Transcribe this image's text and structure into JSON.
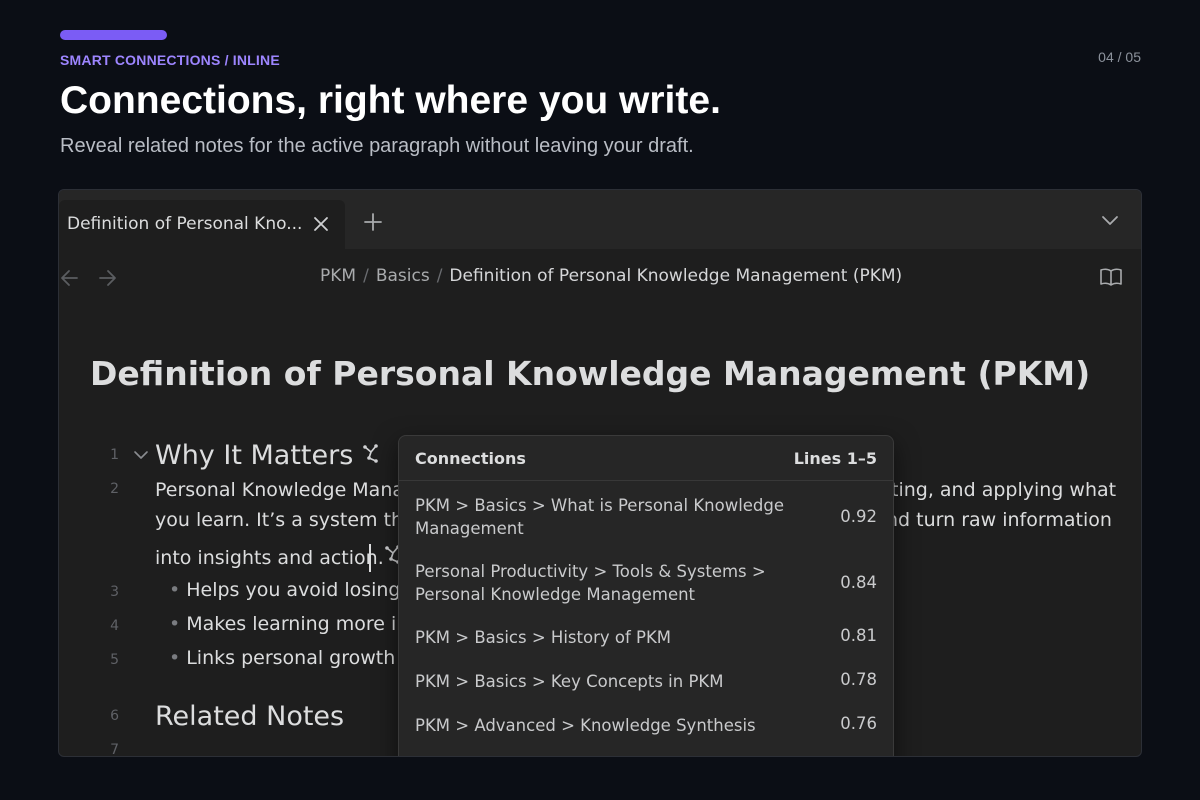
{
  "slide": {
    "eyebrow": "SMART CONNECTIONS / INLINE",
    "counter": "04 / 05",
    "headline": "Connections, right where you write.",
    "subhead": "Reveal related notes for the active paragraph without leaving your draft.",
    "accent_color": "#7b5cf5"
  },
  "tab": {
    "title": "Definition of Personal Kno...",
    "close_icon": "close-icon",
    "new_tab_icon": "plus-icon",
    "tab_list_icon": "chevron-down-icon"
  },
  "nav": {
    "back_icon": "arrow-left-icon",
    "forward_icon": "arrow-right-icon",
    "breadcrumb": [
      "PKM",
      "Basics",
      "Definition of Personal Knowledge Management (PKM)"
    ],
    "separator": "/",
    "reading_view_icon": "book-open-icon"
  },
  "note": {
    "title": "Definition of Personal Knowledge Management (PKM)",
    "line_numbers": [
      "1",
      "2",
      "3",
      "4",
      "5",
      "6",
      "7"
    ],
    "heading_1": "Why It Matters",
    "para_line_1a": "Personal Knowledge Manag",
    "para_line_1b": "ting, and applying what",
    "para_line_2a": "you learn. It’s a system that",
    "para_line_2b": "nd turn raw information",
    "para_line_3": "into insights and action.",
    "bullets": [
      "Helps you avoid losing v",
      "Makes learning more int",
      "Links personal growth to"
    ],
    "bullet_glyph": "•",
    "heading_2": "Related Notes"
  },
  "connections": {
    "title": "Connections",
    "range": "Lines 1–5",
    "results": [
      {
        "path": "PKM > Basics > What is Personal Knowledge Management",
        "score": "0.92"
      },
      {
        "path": "Personal Productivity > Tools & Systems > Personal Knowledge Management",
        "score": "0.84"
      },
      {
        "path": "PKM > Basics > History of PKM",
        "score": "0.81"
      },
      {
        "path": "PKM > Basics > Key Concepts in PKM",
        "score": "0.78"
      },
      {
        "path": "PKM > Advanced > Knowledge Synthesis",
        "score": "0.76"
      }
    ]
  }
}
